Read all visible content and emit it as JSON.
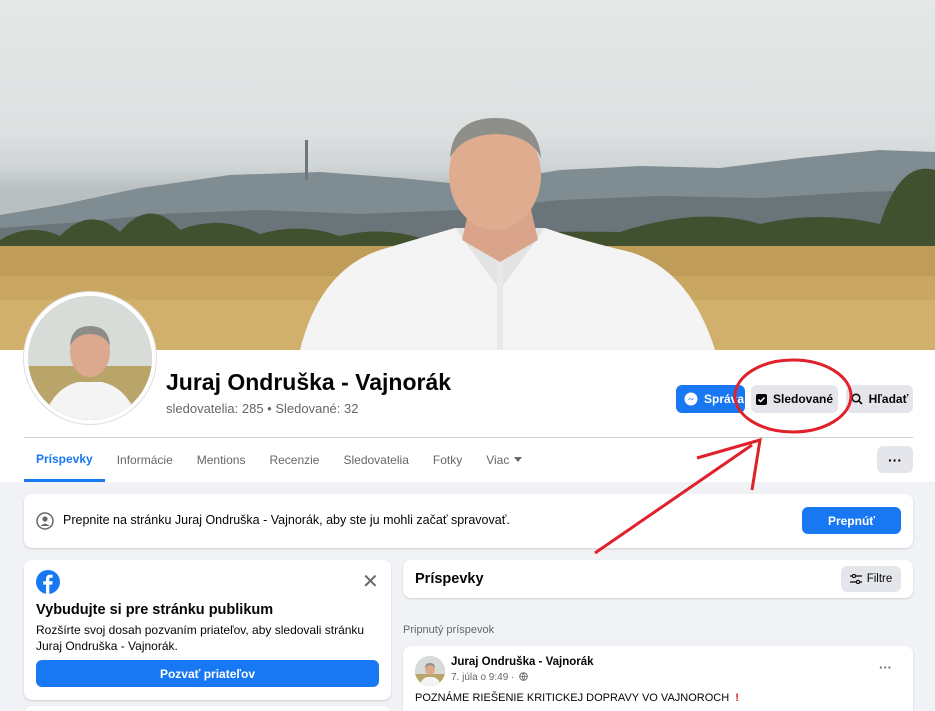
{
  "page": {
    "name": "Juraj Ondruška - Vajnorák",
    "stats": "sledovatelia: 285 • Sledované: 32"
  },
  "actions": {
    "message_label": "Správa",
    "following_label": "Sledované",
    "search_label": "Hľadať"
  },
  "tabs": [
    {
      "label": "Príspevky",
      "active": true
    },
    {
      "label": "Informácie"
    },
    {
      "label": "Mentions"
    },
    {
      "label": "Recenzie"
    },
    {
      "label": "Sledovatelia"
    },
    {
      "label": "Fotky"
    },
    {
      "label": "Viac"
    }
  ],
  "more_label": "···",
  "switch_banner": {
    "text": "Prepnite na stránku Juraj Ondruška - Vajnorák, aby ste ju mohli začať spravovať.",
    "button": "Prepnúť"
  },
  "audience": {
    "title": "Vybudujte si pre stránku publikum",
    "description": "Rozšírte svoj dosah pozvaním priateľov, aby sledovali stránku Juraj Ondruška - Vajnorák.",
    "button": "Pozvať priateľov"
  },
  "posts": {
    "title": "Príspevky",
    "filter_label": "Filtre",
    "pinned_label": "Pripnutý príspevok",
    "items": [
      {
        "author": "Juraj Ondruška - Vajnorák",
        "meta": "7. júla o 9:49 ·",
        "text": "POZNÁME RIEŠENIE KRITICKEJ DOPRAVY VO VAJNOROCH"
      }
    ]
  },
  "colors": {
    "primary": "#1877f2",
    "secondary_button": "#e4e6eb",
    "background": "#f0f2f5",
    "annotation": "#e0202a"
  },
  "icons": [
    "messenger-icon",
    "following-check-icon",
    "search-icon",
    "chevron-down-icon",
    "user-switch-icon",
    "facebook-logo-icon",
    "close-icon",
    "filter-icon",
    "globe-icon",
    "red-exclamation-icon"
  ]
}
